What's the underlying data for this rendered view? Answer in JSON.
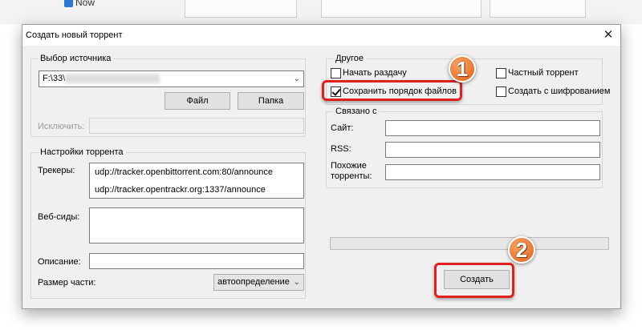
{
  "background_app": {
    "tab_text": "Now"
  },
  "dialog": {
    "title": "Создать новый торрент",
    "close_glyph": "✕"
  },
  "source": {
    "legend": "Выбор источника",
    "path_value": "F:\\33\\",
    "file_button": "Файл",
    "folder_button": "Папка",
    "exclude_label": "Исключить:"
  },
  "settings": {
    "legend": "Настройки торрента",
    "trackers_label": "Трекеры:",
    "trackers": [
      "udp://tracker.openbittorrent.com:80/announce",
      "udp://tracker.opentrackr.org:1337/announce"
    ],
    "webseeds_label": "Веб-сиды:",
    "description_label": "Описание:",
    "piece_size_label": "Размер части:",
    "piece_size_value": "автоопределение"
  },
  "other": {
    "legend": "Другое",
    "start_seeding": {
      "label": "Начать раздачу",
      "checked": false
    },
    "preserve_order": {
      "label": "Сохранить порядок файлов",
      "checked": true
    },
    "private_torrent": {
      "label": "Частный торрент",
      "checked": false
    },
    "encryption": {
      "label": "Создать с шифрованием",
      "checked": false
    }
  },
  "related": {
    "legend": "Связано с",
    "site_label": "Сайт:",
    "rss_label": "RSS:",
    "similar_label_1": "Похожие",
    "similar_label_2": "торренты:"
  },
  "create_button": "Создать",
  "annotations": {
    "badge_1": "1",
    "badge_2": "2",
    "color": "#e0201c"
  }
}
